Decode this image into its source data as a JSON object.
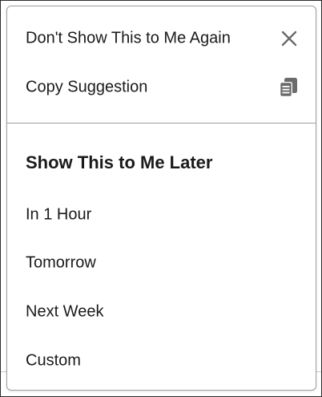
{
  "menu": {
    "actions": [
      {
        "label": "Don't Show This to Me Again",
        "icon": "close-icon"
      },
      {
        "label": "Copy Suggestion",
        "icon": "copy-icon"
      }
    ],
    "section_title": "Show This to Me Later",
    "later_options": [
      {
        "label": "In 1 Hour"
      },
      {
        "label": "Tomorrow"
      },
      {
        "label": "Next Week"
      },
      {
        "label": "Custom"
      }
    ]
  },
  "colors": {
    "text": "#1a1a1a",
    "icon": "#6b6b6b",
    "border": "#9aa0a6"
  }
}
